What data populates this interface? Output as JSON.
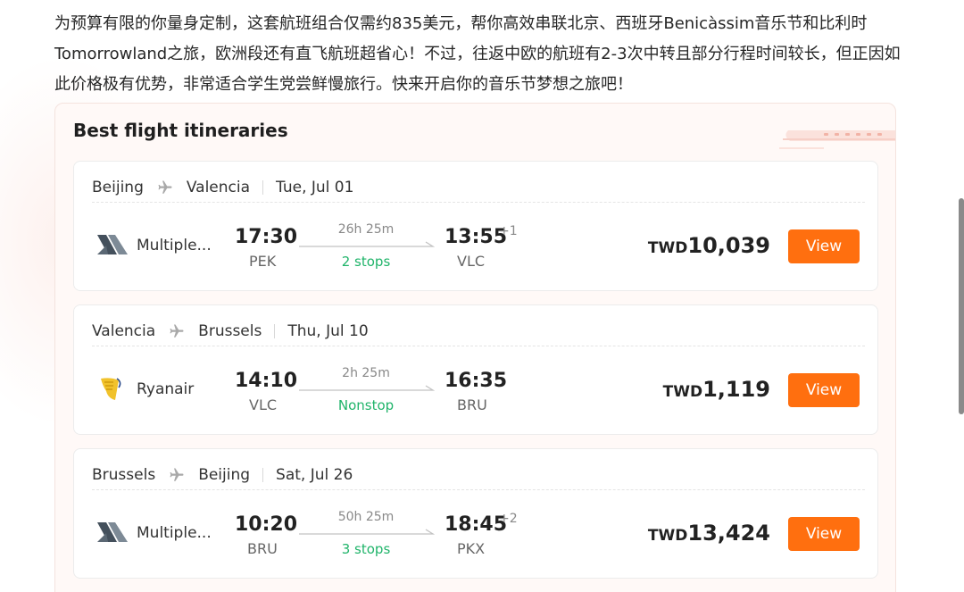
{
  "intro_text": "为预算有限的你量身定制，这套航班组合仅需约835美元，帮你高效串联北京、西班牙Benicàssim音乐节和比利时Tomorrowland之旅，欧洲段还有直飞航班超省心！不过，往返中欧的航班有2-3次中转且部分行程时间较长，但正因如此价格极有优势，非常适合学生党尝鲜慢旅行。快来开启你的音乐节梦想之旅吧！",
  "panel": {
    "title": "Best flight itineraries"
  },
  "colors": {
    "accent": "#ff6f0f",
    "stops_green": "#20b46a"
  },
  "itineraries": [
    {
      "from_city": "Beijing",
      "to_city": "Valencia",
      "date": "Tue, Jul 01",
      "airline": "Multiple...",
      "airline_icon": "multiple-airlines-icon",
      "dep_time": "17:30",
      "dep_code": "PEK",
      "duration": "26h 25m",
      "stops": "2 stops",
      "arr_time": "13:55",
      "arr_day_offset": "+1",
      "arr_code": "VLC",
      "currency": "TWD",
      "price": "10,039",
      "button": "View"
    },
    {
      "from_city": "Valencia",
      "to_city": "Brussels",
      "date": "Thu, Jul 10",
      "airline": "Ryanair",
      "airline_icon": "ryanair-harp-icon",
      "dep_time": "14:10",
      "dep_code": "VLC",
      "duration": "2h 25m",
      "stops": "Nonstop",
      "arr_time": "16:35",
      "arr_day_offset": "",
      "arr_code": "BRU",
      "currency": "TWD",
      "price": "1,119",
      "button": "View"
    },
    {
      "from_city": "Brussels",
      "to_city": "Beijing",
      "date": "Sat, Jul 26",
      "airline": "Multiple...",
      "airline_icon": "multiple-airlines-icon",
      "dep_time": "10:20",
      "dep_code": "BRU",
      "duration": "50h 25m",
      "stops": "3 stops",
      "arr_time": "18:45",
      "arr_day_offset": "+2",
      "arr_code": "PKX",
      "currency": "TWD",
      "price": "13,424",
      "button": "View"
    }
  ]
}
